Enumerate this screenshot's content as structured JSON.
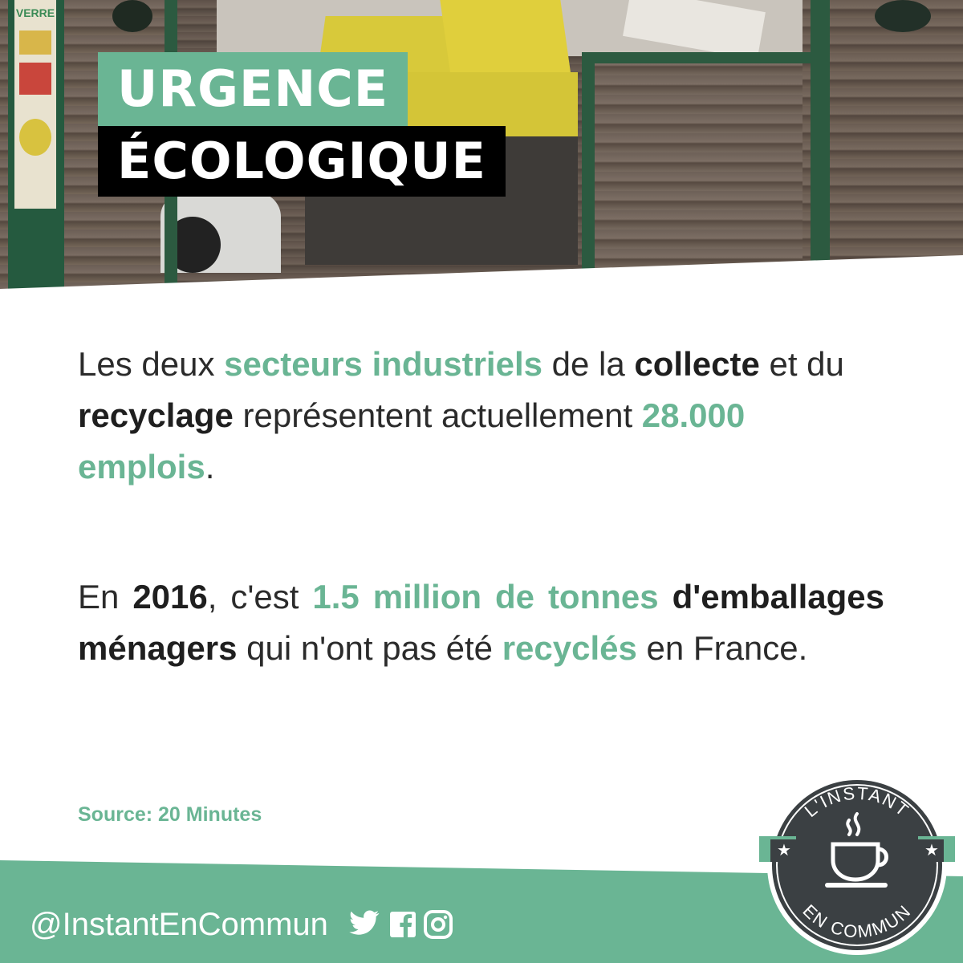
{
  "header": {
    "title_line1": "URGENCE",
    "title_line2": "ÉCOLOGIQUE",
    "photo_sign_text": "VERRE"
  },
  "paragraph1": {
    "t1": "Les deux ",
    "h1": "secteurs industriels",
    "t2": " de la ",
    "h2": "collecte",
    "t3": " et du ",
    "h3": "recyclage",
    "t4": " représentent actuellement ",
    "h4": "28.000 emplois",
    "t5": "."
  },
  "paragraph2": {
    "t1": "En ",
    "h1": "2016",
    "t2": ", c'est ",
    "h2": "1.5 million de tonnes",
    "t3": " ",
    "h3": "d'emballages ménagers",
    "t4": " qui n'ont pas été ",
    "h4": "recyclés",
    "t5": " en France."
  },
  "source": "Source: 20 Minutes",
  "footer": {
    "handle": "@InstantEnCommun",
    "social_icons": [
      "twitter-icon",
      "facebook-icon",
      "instagram-icon"
    ]
  },
  "badge": {
    "top_text": "L'INSTANT",
    "bottom_text": "EN COMMUN",
    "icon": "coffee-cup-icon"
  },
  "colors": {
    "accent_green": "#6ab594",
    "dark": "#2b2b2b",
    "badge_bg": "#3b4043"
  }
}
